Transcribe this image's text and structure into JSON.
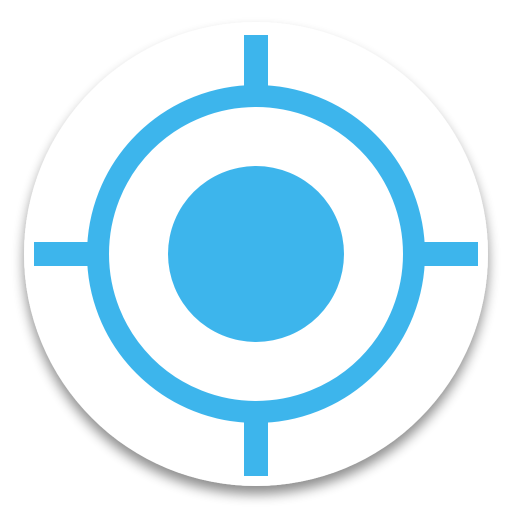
{
  "app_icon": {
    "name": "locate-target-icon",
    "colors": {
      "accent": "#3DB5EC",
      "background": "#FFFFFF",
      "shadow": "#9E9E9E"
    }
  }
}
